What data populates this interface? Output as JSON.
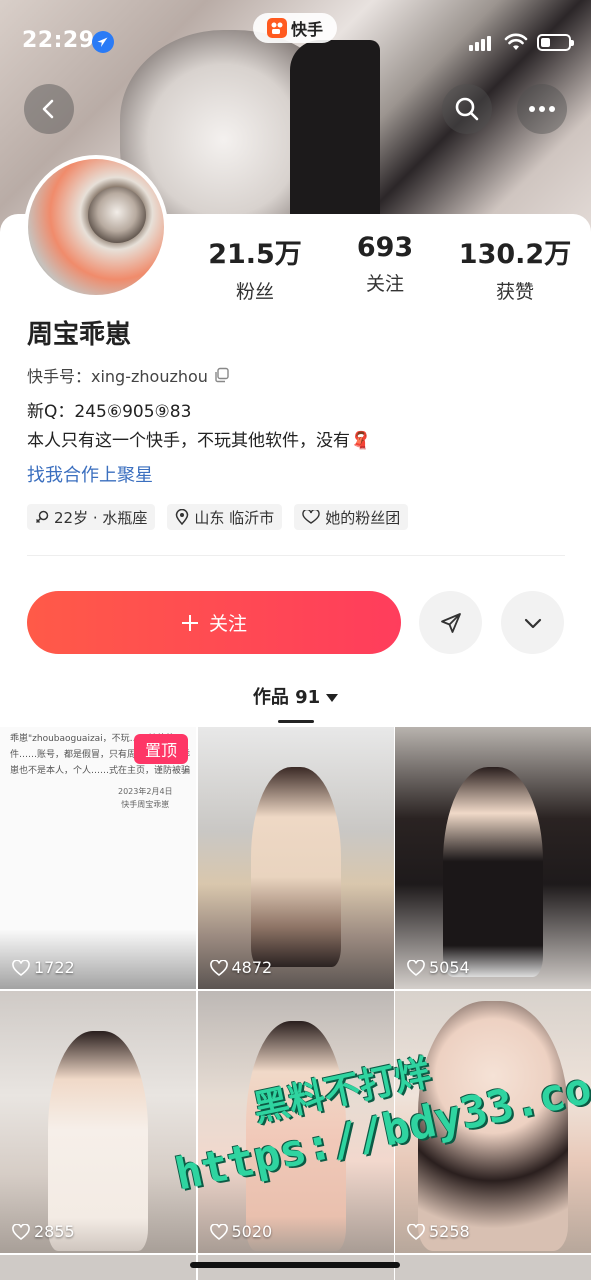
{
  "status_bar": {
    "time": "22:29",
    "app_pill": "快手"
  },
  "profile": {
    "stats": [
      {
        "value": "21.5万",
        "label": "粉丝"
      },
      {
        "value": "693",
        "label": "关注"
      },
      {
        "value": "130.2万",
        "label": "获赞"
      }
    ],
    "name": "周宝乖崽",
    "kuaishou_id": "快手号：xing-zhouzhou",
    "bio_line1": "新Q：245⑥905⑨83",
    "bio_line2": "本人只有这一个快手，不玩其他软件，没有🧣",
    "link": "找我合作上聚星",
    "tags": [
      "22岁 · 水瓶座",
      "山东 临沂市",
      "她的粉丝团"
    ]
  },
  "actions": {
    "follow_label": "关注"
  },
  "works_tab": {
    "label": "作品 91"
  },
  "grid": {
    "pinned_label": "置顶",
    "pinned_text": "乖崽\"zhoubaoguaizai，不玩……其他软件……账号，都是假冒，只有周宝……周周乖崽也不是本人，个人……式在主页，谨防被骗",
    "pinned_sig": "2023年2月4日\n快手周宝乖崽",
    "tiles": [
      {
        "likes": "1722"
      },
      {
        "likes": "4872"
      },
      {
        "likes": "5054"
      },
      {
        "likes": "2855"
      },
      {
        "likes": "5020"
      },
      {
        "likes": "5258"
      }
    ]
  },
  "watermark": {
    "line1": "黑料不打烊",
    "line2": "https://bdy33.co"
  },
  "colors": {
    "follow_gradient_start": "#ff5a48",
    "follow_gradient_end": "#ff3d5c",
    "pinned_badge": "#fe3666",
    "link": "#3b6fbf"
  }
}
